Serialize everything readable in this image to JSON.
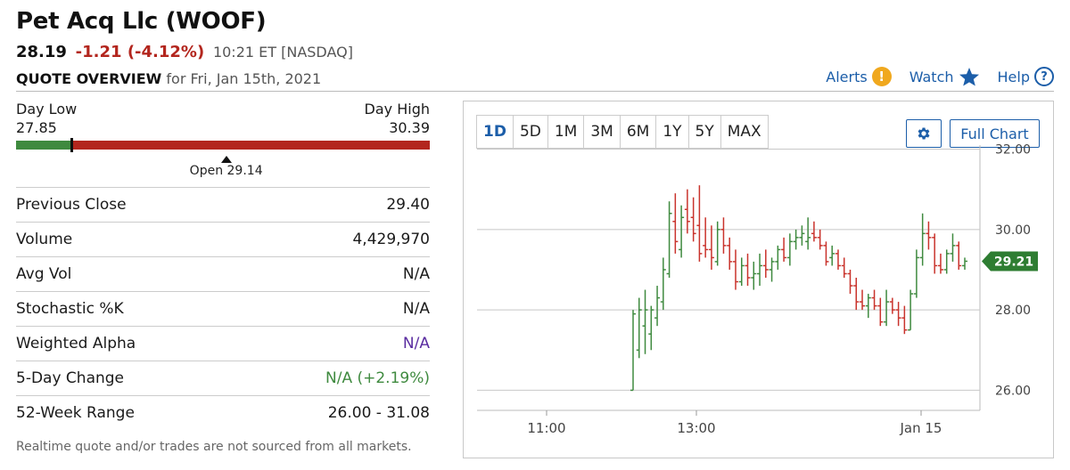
{
  "header": {
    "title": "Pet Acq Llc (WOOF)",
    "last": "28.19",
    "change": "-1.21 (-4.12%)",
    "time_exchange": "10:21 ET [NASDAQ]",
    "overview_label": "QUOTE OVERVIEW",
    "overview_date": "for Fri, Jan 15th, 2021"
  },
  "toplinks": {
    "alerts": "Alerts",
    "alerts_icon": "!",
    "watch": "Watch",
    "help": "Help",
    "help_icon": "?"
  },
  "day_range": {
    "low_label": "Day Low",
    "low": "27.85",
    "high_label": "Day High",
    "high": "30.39",
    "open_label": "Open 29.14",
    "low_value": 27.85,
    "high_value": 30.39,
    "current_value": 28.19,
    "open_value": 29.14
  },
  "stats": [
    {
      "label": "Previous Close",
      "value": "29.40",
      "color": ""
    },
    {
      "label": "Volume",
      "value": "4,429,970",
      "color": ""
    },
    {
      "label": "Avg Vol",
      "value": "N/A",
      "color": ""
    },
    {
      "label": "Stochastic %K",
      "value": "N/A",
      "color": ""
    },
    {
      "label": "Weighted Alpha",
      "value": "N/A",
      "color": "purple"
    },
    {
      "label": "5-Day Change",
      "value": "N/A (+2.19%)",
      "color": "green"
    },
    {
      "label": "52-Week Range",
      "value": "26.00 - 31.08",
      "color": ""
    }
  ],
  "footnote": "Realtime quote and/or trades are not sourced from all markets.",
  "chart_controls": {
    "ranges": [
      "1D",
      "5D",
      "1M",
      "3M",
      "6M",
      "1Y",
      "5Y",
      "MAX"
    ],
    "active_range": "1D",
    "full_chart": "Full Chart"
  },
  "colors": {
    "up": "#3f8a3f",
    "down": "#c9332c",
    "accent": "#1c5ea9",
    "price_tag": "#2e7d32"
  },
  "chart_data": {
    "type": "ohlc",
    "y_ticks": [
      "32.00",
      "30.00",
      "28.00",
      "26.00"
    ],
    "y_tick_values": [
      32,
      30,
      28,
      26
    ],
    "x_ticks": [
      "11:00",
      "13:00",
      "Jan 15"
    ],
    "ylim": [
      25.5,
      32.1
    ],
    "last_price_label": "29.21",
    "last_price": 29.21,
    "bars": [
      {
        "o": 26.0,
        "h": 28.0,
        "l": 26.0,
        "c": 27.9
      },
      {
        "o": 27.0,
        "h": 28.3,
        "l": 26.8,
        "c": 28.0
      },
      {
        "o": 27.6,
        "h": 28.5,
        "l": 26.9,
        "c": 28.0
      },
      {
        "o": 27.4,
        "h": 28.1,
        "l": 27.0,
        "c": 28.0
      },
      {
        "o": 27.8,
        "h": 28.6,
        "l": 27.6,
        "c": 28.3
      },
      {
        "o": 28.2,
        "h": 29.3,
        "l": 28.0,
        "c": 29.0
      },
      {
        "o": 28.9,
        "h": 30.7,
        "l": 28.8,
        "c": 30.4
      },
      {
        "o": 30.2,
        "h": 30.9,
        "l": 29.4,
        "c": 29.7
      },
      {
        "o": 29.5,
        "h": 30.6,
        "l": 29.3,
        "c": 30.3
      },
      {
        "o": 30.5,
        "h": 31.0,
        "l": 29.9,
        "c": 30.2
      },
      {
        "o": 30.3,
        "h": 30.8,
        "l": 29.7,
        "c": 29.9
      },
      {
        "o": 30.1,
        "h": 31.1,
        "l": 29.2,
        "c": 29.4
      },
      {
        "o": 29.6,
        "h": 30.3,
        "l": 29.3,
        "c": 29.5
      },
      {
        "o": 29.5,
        "h": 30.1,
        "l": 29.0,
        "c": 29.3
      },
      {
        "o": 29.2,
        "h": 30.2,
        "l": 29.1,
        "c": 30.0
      },
      {
        "o": 30.0,
        "h": 30.3,
        "l": 29.4,
        "c": 29.6
      },
      {
        "o": 29.6,
        "h": 29.8,
        "l": 29.0,
        "c": 29.2
      },
      {
        "o": 29.2,
        "h": 29.5,
        "l": 28.5,
        "c": 28.7
      },
      {
        "o": 28.7,
        "h": 29.3,
        "l": 28.6,
        "c": 29.1
      },
      {
        "o": 29.1,
        "h": 29.4,
        "l": 28.6,
        "c": 28.8
      },
      {
        "o": 28.8,
        "h": 29.2,
        "l": 28.5,
        "c": 28.9
      },
      {
        "o": 28.9,
        "h": 29.4,
        "l": 28.6,
        "c": 29.1
      },
      {
        "o": 29.1,
        "h": 29.5,
        "l": 28.8,
        "c": 29.0
      },
      {
        "o": 29.0,
        "h": 29.3,
        "l": 28.7,
        "c": 29.2
      },
      {
        "o": 29.2,
        "h": 29.6,
        "l": 29.0,
        "c": 29.5
      },
      {
        "o": 29.5,
        "h": 29.8,
        "l": 29.2,
        "c": 29.3
      },
      {
        "o": 29.3,
        "h": 29.9,
        "l": 29.1,
        "c": 29.7
      },
      {
        "o": 29.7,
        "h": 30.0,
        "l": 29.5,
        "c": 29.8
      },
      {
        "o": 29.8,
        "h": 30.1,
        "l": 29.6,
        "c": 29.9
      },
      {
        "o": 29.7,
        "h": 30.3,
        "l": 29.5,
        "c": 29.8
      },
      {
        "o": 29.9,
        "h": 30.2,
        "l": 29.7,
        "c": 29.8
      },
      {
        "o": 29.8,
        "h": 30.0,
        "l": 29.5,
        "c": 29.6
      },
      {
        "o": 29.6,
        "h": 29.7,
        "l": 29.1,
        "c": 29.2
      },
      {
        "o": 29.3,
        "h": 29.6,
        "l": 29.1,
        "c": 29.4
      },
      {
        "o": 29.4,
        "h": 29.5,
        "l": 29.0,
        "c": 29.1
      },
      {
        "o": 29.1,
        "h": 29.3,
        "l": 28.8,
        "c": 28.9
      },
      {
        "o": 28.9,
        "h": 29.0,
        "l": 28.4,
        "c": 28.6
      },
      {
        "o": 28.6,
        "h": 28.8,
        "l": 28.0,
        "c": 28.2
      },
      {
        "o": 28.2,
        "h": 28.5,
        "l": 28.0,
        "c": 28.1
      },
      {
        "o": 28.1,
        "h": 28.4,
        "l": 27.8,
        "c": 28.3
      },
      {
        "o": 28.3,
        "h": 28.5,
        "l": 28.0,
        "c": 28.1
      },
      {
        "o": 28.1,
        "h": 28.3,
        "l": 27.6,
        "c": 27.7
      },
      {
        "o": 27.7,
        "h": 28.5,
        "l": 27.6,
        "c": 28.2
      },
      {
        "o": 28.2,
        "h": 28.3,
        "l": 27.9,
        "c": 28.0
      },
      {
        "o": 28.0,
        "h": 28.2,
        "l": 27.6,
        "c": 27.8
      },
      {
        "o": 27.8,
        "h": 28.1,
        "l": 27.4,
        "c": 27.5
      },
      {
        "o": 27.5,
        "h": 28.5,
        "l": 27.5,
        "c": 28.4
      },
      {
        "o": 28.4,
        "h": 29.5,
        "l": 28.3,
        "c": 29.3
      },
      {
        "o": 29.3,
        "h": 30.4,
        "l": 29.1,
        "c": 29.9
      },
      {
        "o": 29.9,
        "h": 30.2,
        "l": 29.5,
        "c": 29.8
      },
      {
        "o": 29.8,
        "h": 29.9,
        "l": 28.9,
        "c": 29.1
      },
      {
        "o": 29.1,
        "h": 29.4,
        "l": 28.9,
        "c": 29.0
      },
      {
        "o": 29.0,
        "h": 29.5,
        "l": 28.9,
        "c": 29.4
      },
      {
        "o": 29.4,
        "h": 29.9,
        "l": 29.2,
        "c": 29.6
      },
      {
        "o": 29.6,
        "h": 29.7,
        "l": 29.0,
        "c": 29.1
      },
      {
        "o": 29.1,
        "h": 29.3,
        "l": 29.0,
        "c": 29.21
      }
    ]
  }
}
